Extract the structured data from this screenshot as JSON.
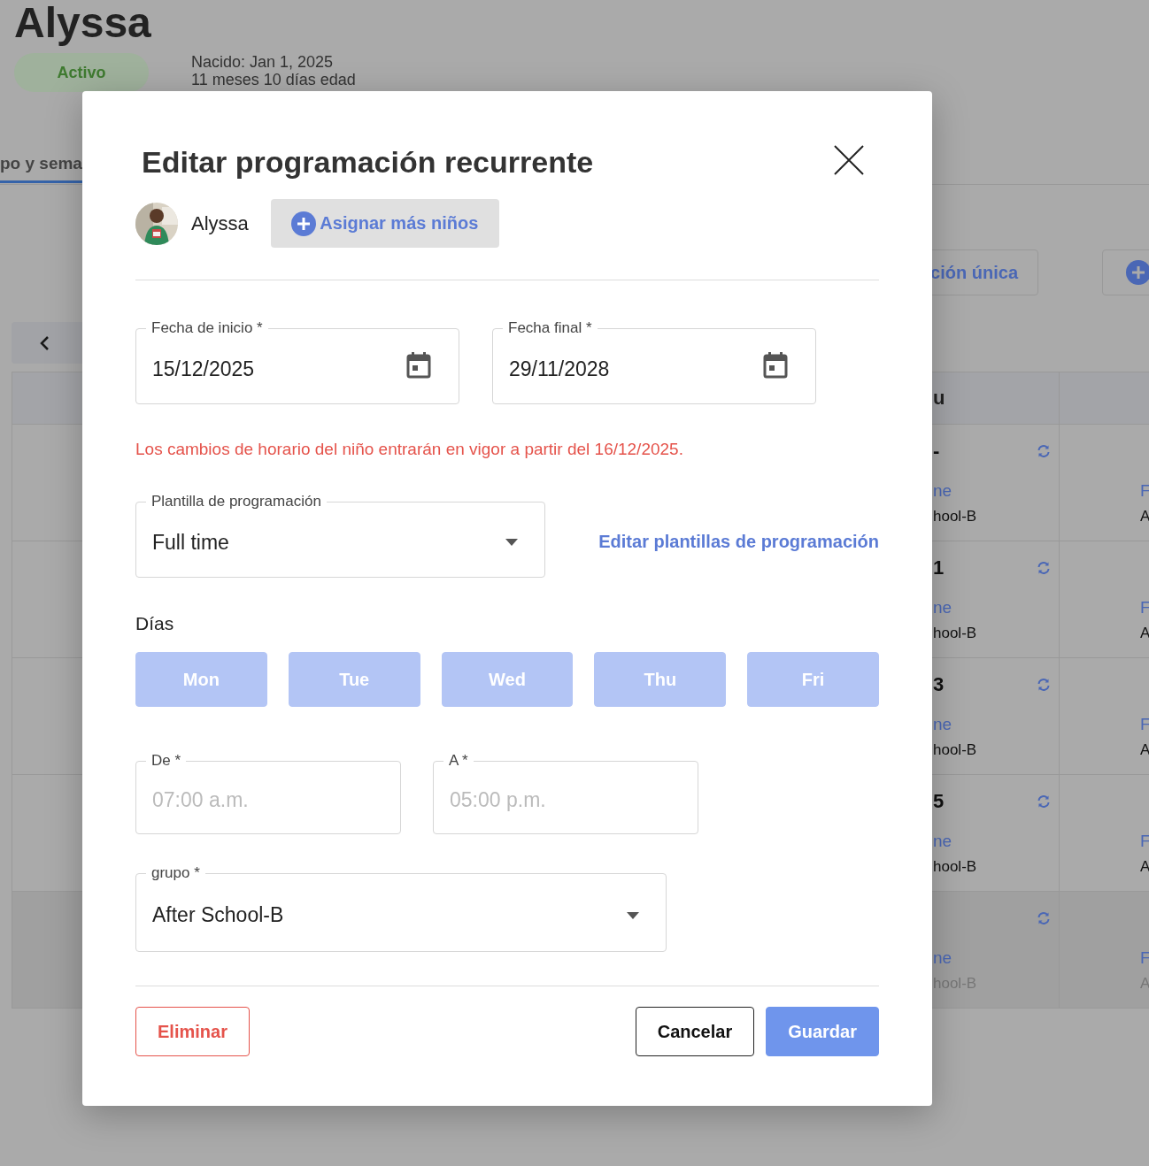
{
  "page": {
    "child_name": "Alyssa",
    "status": "Activo",
    "born": "Nacido: Jan 1, 2025",
    "age": "11 meses 10 días edad",
    "tab_label": "po y sema",
    "one_time_button": "ción única",
    "table": {
      "header": [
        "u"
      ],
      "rows": [
        {
          "number": "-",
          "schedule": "ne",
          "group": "hool-B",
          "next_schedule": "F",
          "next_group": "A",
          "dimmed": false
        },
        {
          "number": "1",
          "schedule": "ne",
          "group": "hool-B",
          "next_schedule": "F",
          "next_group": "A",
          "dimmed": false
        },
        {
          "number": "3",
          "schedule": "ne",
          "group": "hool-B",
          "next_schedule": "F",
          "next_group": "A",
          "dimmed": false
        },
        {
          "number": "5",
          "schedule": "ne",
          "group": "hool-B",
          "next_schedule": "F",
          "next_group": "A",
          "dimmed": false
        },
        {
          "number": "",
          "schedule": "ne",
          "group": "hool-B",
          "next_schedule": "F",
          "next_group": "A",
          "dimmed": true
        }
      ]
    }
  },
  "dialog": {
    "title": "Editar programación recurrente",
    "child": {
      "name": "Alyssa"
    },
    "assign_button": "Asignar más niños",
    "start_date": {
      "label": "Fecha de inicio *",
      "value": "15/12/2025"
    },
    "end_date": {
      "label": "Fecha final *",
      "value": "29/11/2028"
    },
    "notice": "Los cambios de horario del niño entrarán en vigor a partir del 16/12/2025.",
    "template": {
      "label": "Plantilla de programación",
      "value": "Full time"
    },
    "edit_templates_link": "Editar plantillas de programación",
    "days_label": "Días",
    "days": [
      {
        "label": "Mon",
        "selected": true
      },
      {
        "label": "Tue",
        "selected": true
      },
      {
        "label": "Wed",
        "selected": true
      },
      {
        "label": "Thu",
        "selected": true
      },
      {
        "label": "Fri",
        "selected": true
      }
    ],
    "days_disabled": true,
    "from": {
      "label": "De *",
      "placeholder": "07:00 a.m."
    },
    "to": {
      "label": "A *",
      "placeholder": "05:00 p.m."
    },
    "group": {
      "label": "grupo *",
      "value": "After School-B"
    },
    "buttons": {
      "delete": "Eliminar",
      "cancel": "Cancelar",
      "save": "Guardar"
    }
  }
}
